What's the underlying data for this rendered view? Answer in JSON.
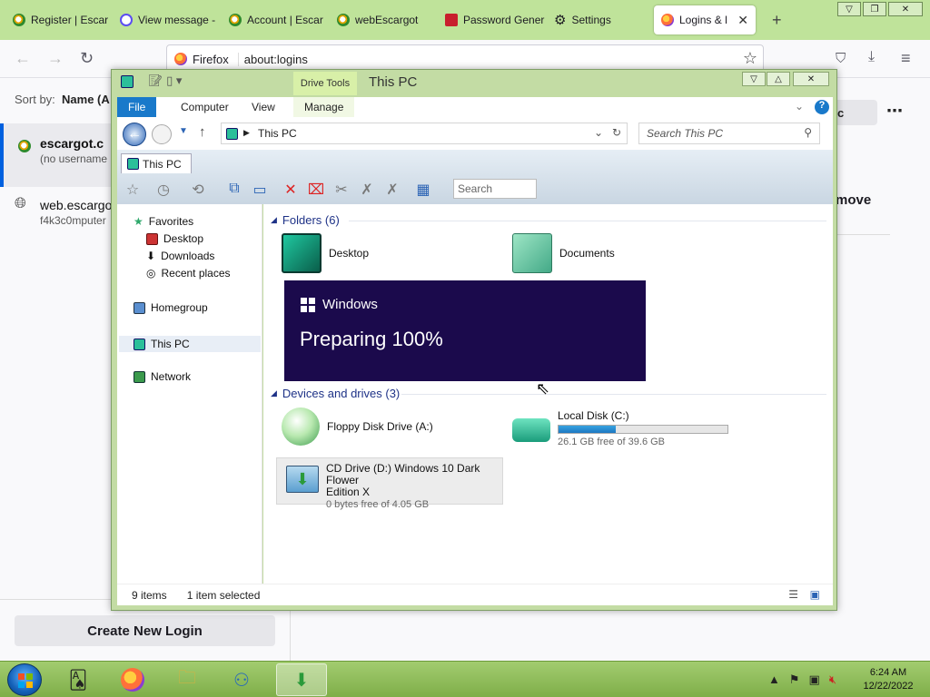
{
  "browser": {
    "tabs": [
      {
        "label": "Register | Escar",
        "icon": "g"
      },
      {
        "label": "View message -",
        "icon": "at"
      },
      {
        "label": "Account | Escar",
        "icon": "g"
      },
      {
        "label": "webEscargot",
        "icon": "g"
      },
      {
        "label": "Password Gener",
        "icon": "pw"
      },
      {
        "label": "Settings",
        "icon": "gear"
      },
      {
        "label": "Logins & Pass",
        "icon": "ff"
      }
    ],
    "identity": "Firefox",
    "url": "about:logins"
  },
  "logins_page": {
    "sort_label": "Sort by:",
    "sort_value": "Name (A",
    "entries": [
      {
        "title": "escargot.c",
        "subtitle": "(no username"
      },
      {
        "title": "web.escargo",
        "subtitle": "f4k3c0mputer"
      }
    ],
    "create_button": "Create New Login",
    "right_button_fragment": "c",
    "remove_fragment": "move"
  },
  "explorer": {
    "title": "This PC",
    "context_tab": "Drive Tools",
    "ribbon_tabs": [
      "File",
      "Computer",
      "View",
      "Manage"
    ],
    "address": "This PC",
    "search_placeholder": "Search This PC",
    "breadcrumb_tab": "This PC",
    "toolbar_search": "Search",
    "nav": {
      "favorites": "Favorites",
      "desktop": "Desktop",
      "downloads": "Downloads",
      "recent": "Recent places",
      "homegroup": "Homegroup",
      "thispc": "This PC",
      "network": "Network"
    },
    "folders_header": "Folders (6)",
    "folders": [
      {
        "name": "Desktop"
      },
      {
        "name": "Documents"
      }
    ],
    "devices_header": "Devices and drives (3)",
    "drives": {
      "floppy": "Floppy Disk Drive (A:)",
      "local_name": "Local Disk (C:)",
      "local_free": "26.1 GB free of 39.6 GB",
      "local_used_fraction": 0.34,
      "cd_name": "CD Drive (D:) Windows 10 Dark Flower",
      "cd_name2": "Edition X",
      "cd_free": "0 bytes free of 4.05 GB"
    },
    "status_items": "9 items",
    "status_selected": "1 item selected"
  },
  "overlay": {
    "brand": "Windows",
    "message": "Preparing 100%"
  },
  "taskbar": {
    "time": "6:24 AM",
    "date": "12/22/2022"
  }
}
